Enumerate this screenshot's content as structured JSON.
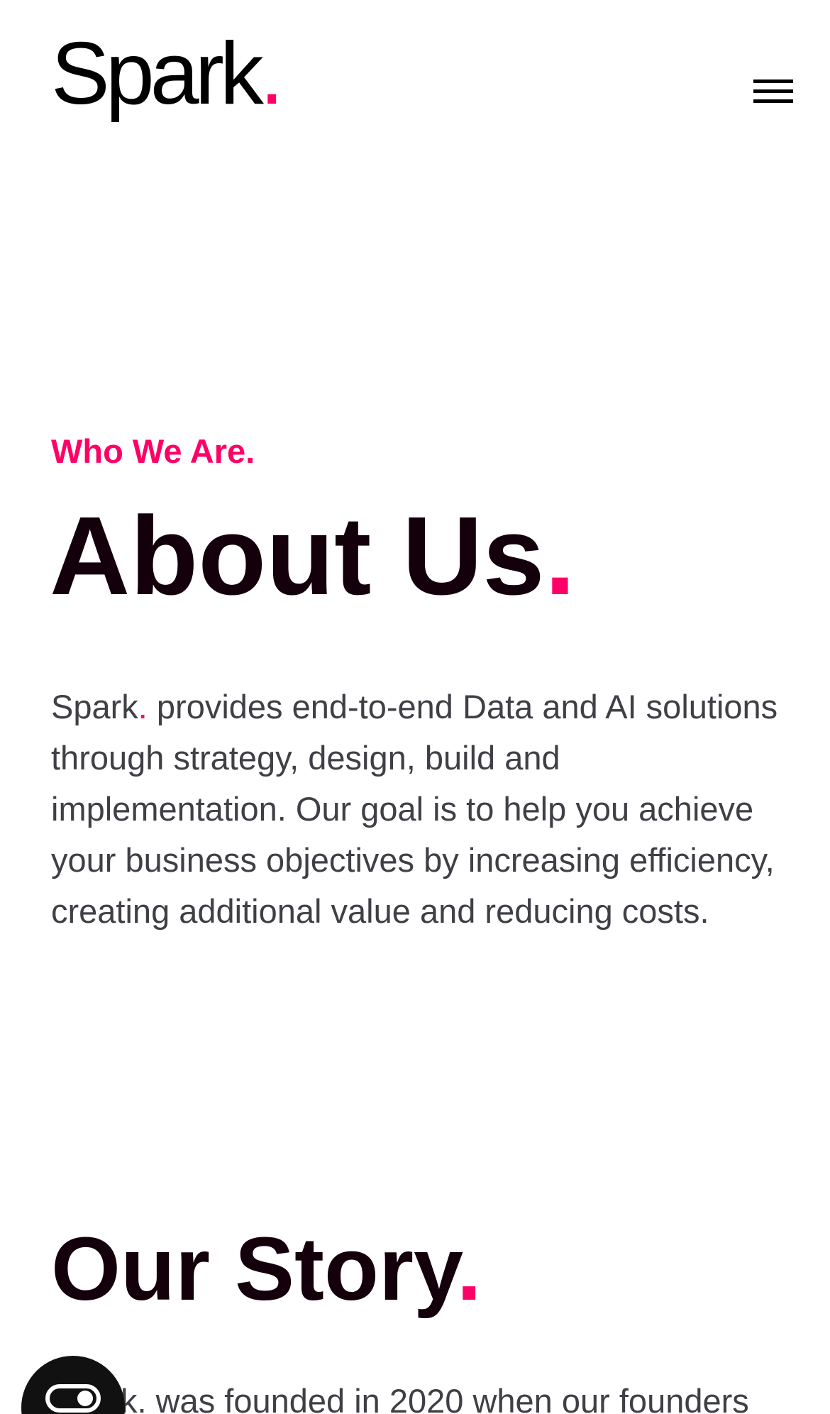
{
  "header": {
    "logo_text": "Spark",
    "logo_dot": ".",
    "menu_icon": "hamburger-menu-icon"
  },
  "about": {
    "eyebrow": "Who We Are.",
    "title": "About Us",
    "title_dot": ".",
    "intro_brand": "Spark",
    "intro_dot": ".",
    "intro_text": " provides end-to-end Data and AI solutions through strategy, design, build and implementation. Our goal is to help you achieve your business objectives by increasing efficiency, creating additional value and reducing costs."
  },
  "story": {
    "title": "Our Story",
    "title_dot": ".",
    "text_visible": "k. was founded in 2020 when our founders"
  },
  "chat_widget": {
    "icon": "chat-toggle-icon"
  },
  "colors": {
    "accent": "#ff0066",
    "heading": "#14000a",
    "body_text": "#3f3f46",
    "background": "#ffffff",
    "widget": "#111111"
  }
}
